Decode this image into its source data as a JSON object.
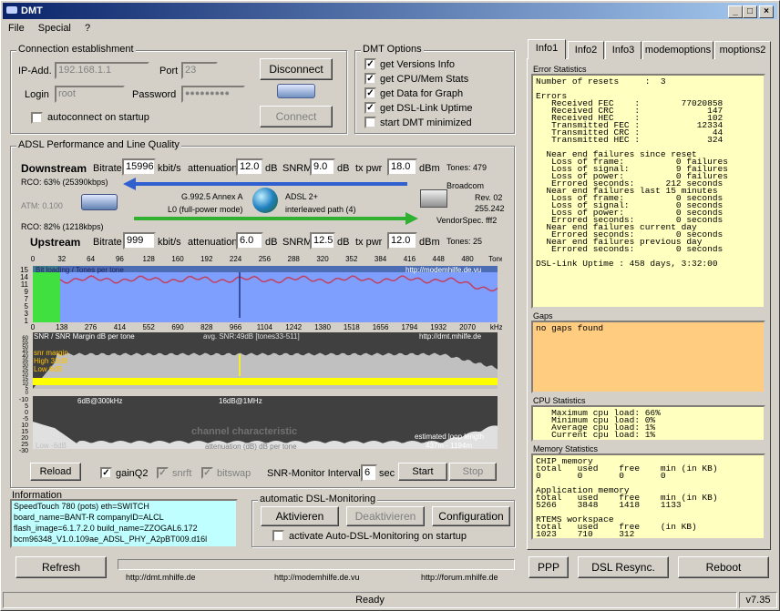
{
  "window": {
    "title": "DMT"
  },
  "menu": [
    "File",
    "Special",
    "?"
  ],
  "connection": {
    "group_title": "Connection establishment",
    "ip_label": "IP-Add.",
    "ip_value": "192.168.1.1",
    "port_label": "Port",
    "port_value": "23",
    "login_label": "Login",
    "login_value": "root",
    "password_label": "Password",
    "password_value": "●●●●●●●●●",
    "disconnect_label": "Disconnect",
    "connect_label": "Connect",
    "autoconnect_label": "autoconnect on startup"
  },
  "dmt_options": {
    "group_title": "DMT Options",
    "items": [
      {
        "label": "get Versions Info",
        "checked": true
      },
      {
        "label": "get CPU/Mem Stats",
        "checked": true
      },
      {
        "label": "get Data for Graph",
        "checked": true
      },
      {
        "label": "get DSL-Link Uptime",
        "checked": true
      },
      {
        "label": "start DMT minimized",
        "checked": false
      }
    ]
  },
  "adsl": {
    "group_title": "ADSL Performance and Line Quality",
    "downstream": {
      "label": "Downstream",
      "bitrate": "15996",
      "attenuation": "12.0",
      "snrm": "9.0",
      "txpwr": "18.0",
      "tones": "Tones: 479"
    },
    "upstream": {
      "label": "Upstream",
      "bitrate": "999",
      "attenuation": "6.0",
      "snrm": "12.5",
      "txpwr": "12.0",
      "tones": "Tones: 25"
    },
    "bitrate_label": "Bitrate",
    "kbits": "kbit/s",
    "att_label": "attenuation",
    "db": "dB",
    "snrm_label": "SNRM",
    "txpwr_label": "tx pwr",
    "dbm": "dBm",
    "rco_down": "RCO: 63% (25390kbps)",
    "atm": "ATM: 0.100",
    "rco_up": "RCO: 82% (1218kbps)",
    "mode1": "G.992.5 Annex A",
    "mode2": "L0 (full-power mode)",
    "mode3": "ADSL 2+",
    "mode4": "interleaved path (4)",
    "vendor": "Broadcom",
    "rev": "Rev. 02",
    "rev2": "255.242",
    "vendorspec": "VendorSpec. fff2"
  },
  "graphs": {
    "bits_header": "Bit loading / Tones per tone",
    "bits_url": "http://modemhilfe.de.vu",
    "snr_header": "SNR / SNR Margin  dB per tone",
    "snr_avg": "avg. SNR:49dB  [tones33-511]",
    "snr_url": "http://dmt.mhilfe.de",
    "snr_margin": "snr margin",
    "snr_high": "High 33dB",
    "snr_low": "Low  6dB",
    "ch_6db": "6dB@300kHz",
    "ch_16db": "16dB@1MHz",
    "ch_title": "channel characteristic",
    "ch_att": "attenuation (dB)  dB per tone",
    "ch_low": "Low  -6dB",
    "ch_est": "estimated loop length",
    "ch_est2": "437m - 1194m",
    "tone_axis": [
      "0",
      "32",
      "64",
      "96",
      "128",
      "160",
      "192",
      "224",
      "256",
      "288",
      "320",
      "352",
      "384",
      "416",
      "448",
      "480",
      "Tone"
    ],
    "khz_axis": [
      "0",
      "138",
      "276",
      "414",
      "552",
      "690",
      "828",
      "966",
      "1104",
      "1242",
      "1380",
      "1518",
      "1656",
      "1794",
      "1932",
      "2070",
      "kHz"
    ],
    "bits_y": [
      "15",
      "14",
      "11",
      "9",
      "7",
      "5",
      "3",
      "1"
    ],
    "snr_y": [
      "60",
      "55",
      "50",
      "45",
      "40",
      "35",
      "30",
      "25",
      "20",
      "15",
      "10",
      "5",
      "0"
    ],
    "ch_y": [
      "-10",
      "5",
      "0",
      "-5",
      "10",
      "15",
      "20",
      "25",
      "-30"
    ]
  },
  "controls": {
    "reload": "Reload",
    "gainq2": "gainQ2",
    "snrft": "snrft",
    "bitswap": "bitswap",
    "snr_monitor": "SNR-Monitor Interval:",
    "interval": "6",
    "sec": "sec",
    "start": "Start",
    "stop": "Stop"
  },
  "information": {
    "title": "Information",
    "lines": [
      "SpeedTouch 780 (pots) eth=SWITCH",
      "board_name=BANT-R   companyID=ALCL",
      "flash_image=6.1.7.2.0  build_name=ZZOGAL6.172",
      "bcm96348_V1.0.109ae_ADSL_PHY_A2pBT009.d16l"
    ]
  },
  "auto_monitor": {
    "title": "automatic DSL-Monitoring",
    "activate": "Aktivieren",
    "deactivate": "Deaktivieren",
    "config": "Configuration",
    "startup": "activate Auto-DSL-Monitoring on startup"
  },
  "bottom": {
    "refresh": "Refresh",
    "link1": "http://dmt.mhilfe.de",
    "link2": "http://modemhilfe.de.vu",
    "link3": "http://forum.mhilfe.de",
    "ppp": "PPP",
    "resync": "DSL Resync.",
    "reboot": "Reboot",
    "status": "Ready",
    "version": "v7.35"
  },
  "tabs": [
    "Info1",
    "Info2",
    "Info3",
    "modemoptions",
    "moptions2"
  ],
  "error_stats": {
    "title": "Error Statistics",
    "text": "Number of resets     :  3\n\nErrors\n   Received FEC    :        77020858\n   Received CRC    :             147\n   Received HEC    :             102\n   Transmitted FEC :           12334\n   Transmitted CRC :              44\n   Transmitted HEC :             324\n\n  Near end failures since reset\n   Loss of frame:          0 failures\n   Loss of signal:         9 failures\n   Loss of power:          0 failures\n   Errored seconds:      212 seconds\n  Near end failures last 15 minutes\n   Loss of frame:          0 seconds\n   Loss of signal:         0 seconds\n   Loss of power:          0 seconds\n   Errored seconds:        0 seconds\n  Near end failures current day\n   Errored seconds:        0 seconds\n  Near end failures previous day\n   Errored seconds:        0 seconds\n\nDSL-Link Uptime : 458 days, 3:32:00"
  },
  "gaps": {
    "title": "Gaps",
    "text": "no gaps found"
  },
  "cpu": {
    "title": "CPU Statistics",
    "text": "   Maximum cpu load: 66%\n   Minimum cpu load: 0%\n   Average cpu load: 1%\n   Current cpu load: 1%"
  },
  "memory": {
    "title": "Memory Statistics",
    "text": "CHIP memory\ntotal   used    free    min (in KB)\n0       0       0       0\n\nApplication memory\ntotal   used    free    min (in KB)\n5266    3848    1418    1133\n\nRTEMS workspace\ntotal   used    free    (in KB)\n1023    710     312"
  },
  "colors": {
    "accent": "#0a246a",
    "panel_yellow": "#ffffc0",
    "gaps_orange": "#ffcc80",
    "info_cyan": "#c0ffff",
    "bits_blue": "#7f9fff",
    "snr_yellow": "#ffff00"
  }
}
